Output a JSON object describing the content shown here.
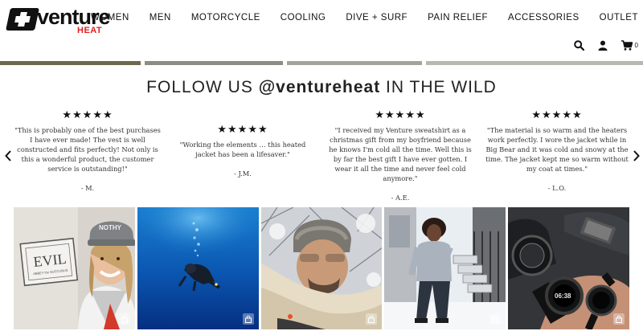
{
  "brand": {
    "name": "venture",
    "subname": "HEAT"
  },
  "nav": {
    "items": [
      {
        "label": "WOMEN"
      },
      {
        "label": "MEN"
      },
      {
        "label": "MOTORCYCLE"
      },
      {
        "label": "COOLING"
      },
      {
        "label": "DIVE + SURF"
      },
      {
        "label": "PAIN RELIEF"
      },
      {
        "label": "ACCESSORIES"
      },
      {
        "label": "OUTLET"
      }
    ],
    "cart_count": "0",
    "icons": [
      "search-icon",
      "account-icon",
      "cart-icon"
    ]
  },
  "follow": {
    "prefix": "FOLLOW US ",
    "handle": "@ventureheat",
    "suffix": " IN THE WILD"
  },
  "reviews": [
    {
      "stars": "★★★★★",
      "text": "\"This is probably one of the best purchases I have ever made! The vest is well constructed and fits perfectly! Not only is this a wonderful product, the customer service is outstanding!\"",
      "author": "- M."
    },
    {
      "stars": "★★★★★",
      "text": "\"Working the elements … this heated jacket has been a lifesaver.\"",
      "author": "- J.M."
    },
    {
      "stars": "★★★★★",
      "text": "\"I received my Venture sweatshirt as a christmas gift from my boyfriend because he knows I'm cold all the time. Well this is by far the best gift I have ever gotten. I wear it all the time and never feel cold anymore.\"",
      "author": "- A.E."
    },
    {
      "stars": "★★★★★",
      "text": "\"The material is so warm and the heaters work perfectly. I wore the jacket while in Big Bear and it was cold and snowy at the time. The jacket kept me so warm without my coat at times.\"",
      "author": "- L.O."
    }
  ],
  "photos": [
    {
      "name": "photo-woman-evil-sign",
      "sign_text": "EVIL",
      "sign_sub": "ABBEY the SUCCUBUS",
      "cap_text": "NOTHY"
    },
    {
      "name": "photo-diver-underwater"
    },
    {
      "name": "photo-man-snow-selfie"
    },
    {
      "name": "photo-woman-snow-steps"
    },
    {
      "name": "photo-watches-jacket",
      "watch_text": "06:38"
    }
  ],
  "colors": {
    "brand_red": "#e02020",
    "text_dark": "#111111"
  }
}
